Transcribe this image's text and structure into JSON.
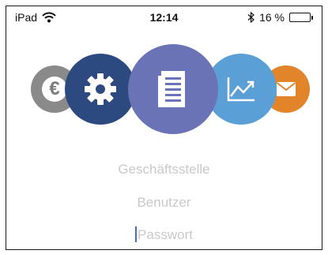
{
  "status_bar": {
    "device": "iPad",
    "time": "12:14",
    "battery_label": "16 %",
    "battery_level": 0.16
  },
  "menu": [
    {
      "name": "euro",
      "icon": "euro-icon",
      "color": "#8a8a8a"
    },
    {
      "name": "settings",
      "icon": "gear-icon",
      "color": "#2d4a80"
    },
    {
      "name": "documents",
      "icon": "document-icon",
      "color": "#6a73b5"
    },
    {
      "name": "statistics",
      "icon": "chart-icon",
      "color": "#5a9fd6"
    },
    {
      "name": "mail",
      "icon": "mail-icon",
      "color": "#e2852a"
    }
  ],
  "login": {
    "office_placeholder": "Geschäftsstelle",
    "user_placeholder": "Benutzer",
    "password_placeholder": "Passwort"
  }
}
